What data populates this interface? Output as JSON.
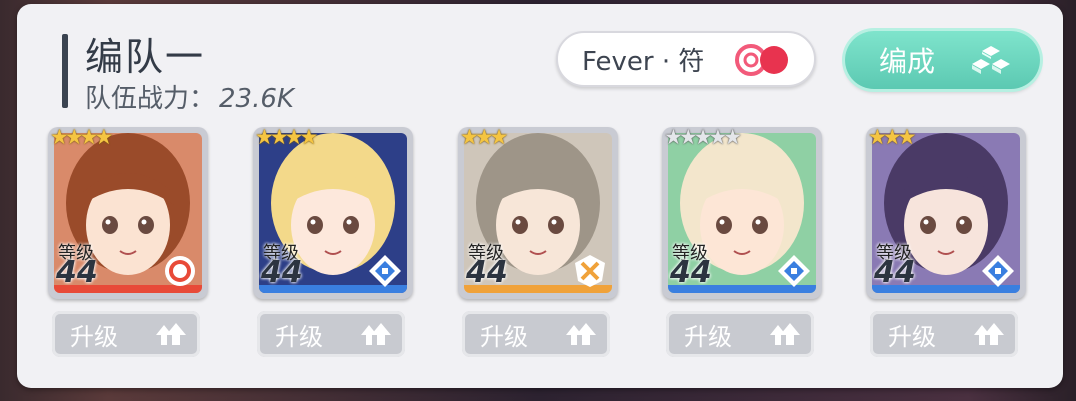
{
  "team": {
    "title": "编队一",
    "power_label": "队伍战力：",
    "power_value": "23.6K"
  },
  "fever": {
    "label": "Fever · 符",
    "toggle_icon": "fever-toggle-icon",
    "colors": {
      "ring": "#f25a7a",
      "fill": "#e8334f"
    }
  },
  "formation_button": {
    "label": "编成",
    "icon": "cubes-icon",
    "color": "#62ccb5"
  },
  "cards": [
    {
      "stars": "★★★★",
      "star_color": "gold",
      "level_label": "等级",
      "level": "44",
      "attr_icon": "sun-emblem-icon",
      "attr_color": "#e84a38",
      "hair": "#9a4b2a",
      "skin": "#fbe3d2",
      "bg": "#d98a6a",
      "upgrade_label": "升级"
    },
    {
      "stars": "★★★★",
      "star_color": "gold",
      "level_label": "等级",
      "level": "44",
      "attr_icon": "diamond-cross-icon",
      "attr_color": "#3a7fe0",
      "hair": "#f3d98a",
      "skin": "#fde8dc",
      "bg": "#2d3f88",
      "upgrade_label": "升级"
    },
    {
      "stars": "★★★",
      "star_color": "gold",
      "level_label": "等级",
      "level": "44",
      "attr_icon": "shield-x-icon",
      "attr_color": "#f0a23a",
      "hair": "#9e9588",
      "skin": "#f7e6d8",
      "bg": "#cfc6ba",
      "upgrade_label": "升级"
    },
    {
      "stars": "★★★★★",
      "star_color": "silver",
      "level_label": "等级",
      "level": "44",
      "attr_icon": "diamond-cross-icon",
      "attr_color": "#3a7fe0",
      "hair": "#f3e6cc",
      "skin": "#fde6d6",
      "bg": "#8fd0a4",
      "upgrade_label": "升级"
    },
    {
      "stars": "★★★",
      "star_color": "gold",
      "level_label": "等级",
      "level": "44",
      "attr_icon": "diamond-cross-icon",
      "attr_color": "#3a7fe0",
      "hair": "#4a3a66",
      "skin": "#f7e4dc",
      "bg": "#8a7ab4",
      "upgrade_label": "升级"
    }
  ]
}
